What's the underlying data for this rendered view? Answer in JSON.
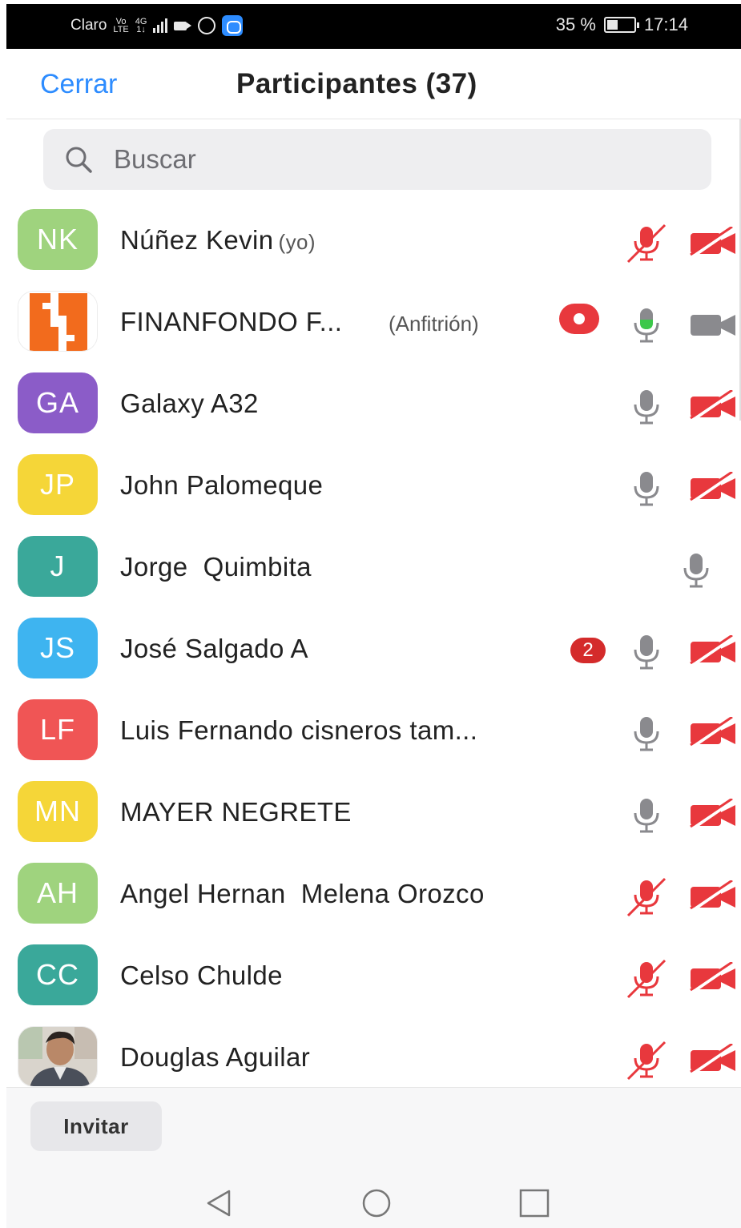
{
  "status_bar": {
    "carrier": "Claro",
    "volte": "Vo",
    "lte": "LTE",
    "network": "4G",
    "network_sub": "1↓",
    "battery": "35 %",
    "time": "17:14",
    "icons": [
      "signal-icon",
      "video-camera-icon",
      "whatsapp-icon",
      "zoom-app-icon",
      "battery-icon"
    ]
  },
  "header": {
    "close_label": "Cerrar",
    "title": "Participantes (37)"
  },
  "search": {
    "placeholder": "Buscar"
  },
  "colors": {
    "accent": "#2d8cff",
    "muted_red": "#e8383d",
    "mic_gray": "#8a8a8e",
    "talk_green": "#3cc84a",
    "badge_red": "#d42b2b"
  },
  "participants": [
    {
      "initials": "NK",
      "name": "Núñez Kevin",
      "tag": "(yo)",
      "avatar_color": "#9fd37e",
      "mic": "muted",
      "video": "off"
    },
    {
      "initials": "",
      "name": "FINANFONDO F...",
      "tag": "(Anfitrión)",
      "avatar_color": "#f26b1d",
      "mic": "talking",
      "video": "on",
      "recording": true
    },
    {
      "initials": "GA",
      "name": "Galaxy A32",
      "tag": "",
      "avatar_color": "#8b5cc8",
      "mic": "on",
      "video": "off"
    },
    {
      "initials": "JP",
      "name": "John Palomeque",
      "tag": "",
      "avatar_color": "#f5d638",
      "mic": "on",
      "video": "off"
    },
    {
      "initials": "J",
      "name": "Jorge  Quimbita",
      "tag": "",
      "avatar_color": "#3aa89a",
      "mic": "on",
      "video": "none"
    },
    {
      "initials": "JS",
      "name": "José Salgado A",
      "tag": "",
      "avatar_color": "#3eb4f0",
      "mic": "on",
      "video": "off",
      "badge": "2"
    },
    {
      "initials": "LF",
      "name": "Luis Fernando cisneros tam...",
      "tag": "",
      "avatar_color": "#f05555",
      "mic": "on",
      "video": "off"
    },
    {
      "initials": "MN",
      "name": "MAYER NEGRETE",
      "tag": "",
      "avatar_color": "#f5d638",
      "mic": "on",
      "video": "off"
    },
    {
      "initials": "AH",
      "name": "Angel Hernan  Melena Orozco",
      "tag": "",
      "avatar_color": "#9fd37e",
      "mic": "muted",
      "video": "off"
    },
    {
      "initials": "CC",
      "name": "Celso Chulde",
      "tag": "",
      "avatar_color": "#3aa89a",
      "mic": "muted",
      "video": "off"
    },
    {
      "initials": "",
      "name": "Douglas Aguilar",
      "tag": "",
      "avatar_color": "#c9c3bb",
      "mic": "muted",
      "video": "off",
      "photo": true
    }
  ],
  "footer": {
    "invite_label": "Invitar"
  }
}
